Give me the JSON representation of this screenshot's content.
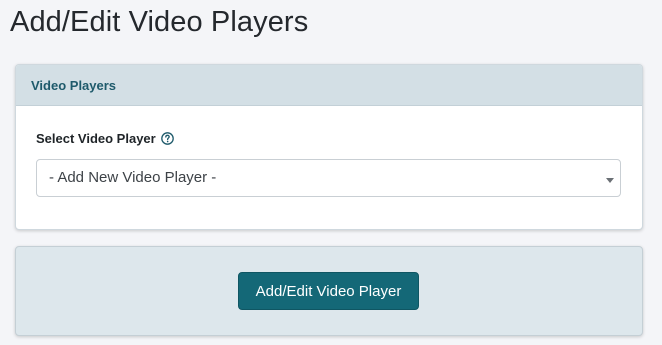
{
  "page": {
    "title": "Add/Edit Video Players"
  },
  "panel": {
    "header_title": "Video Players",
    "field_label": "Select Video Player",
    "help_icon": "question-circle-icon",
    "select": {
      "selected_value": "- Add New Video Player -"
    }
  },
  "actions": {
    "submit_label": "Add/Edit Video Player"
  },
  "colors": {
    "accent": "#146877",
    "header_bg": "#d3dfe5",
    "header_text": "#1e5a6b",
    "page_bg": "#f4f5f8"
  }
}
